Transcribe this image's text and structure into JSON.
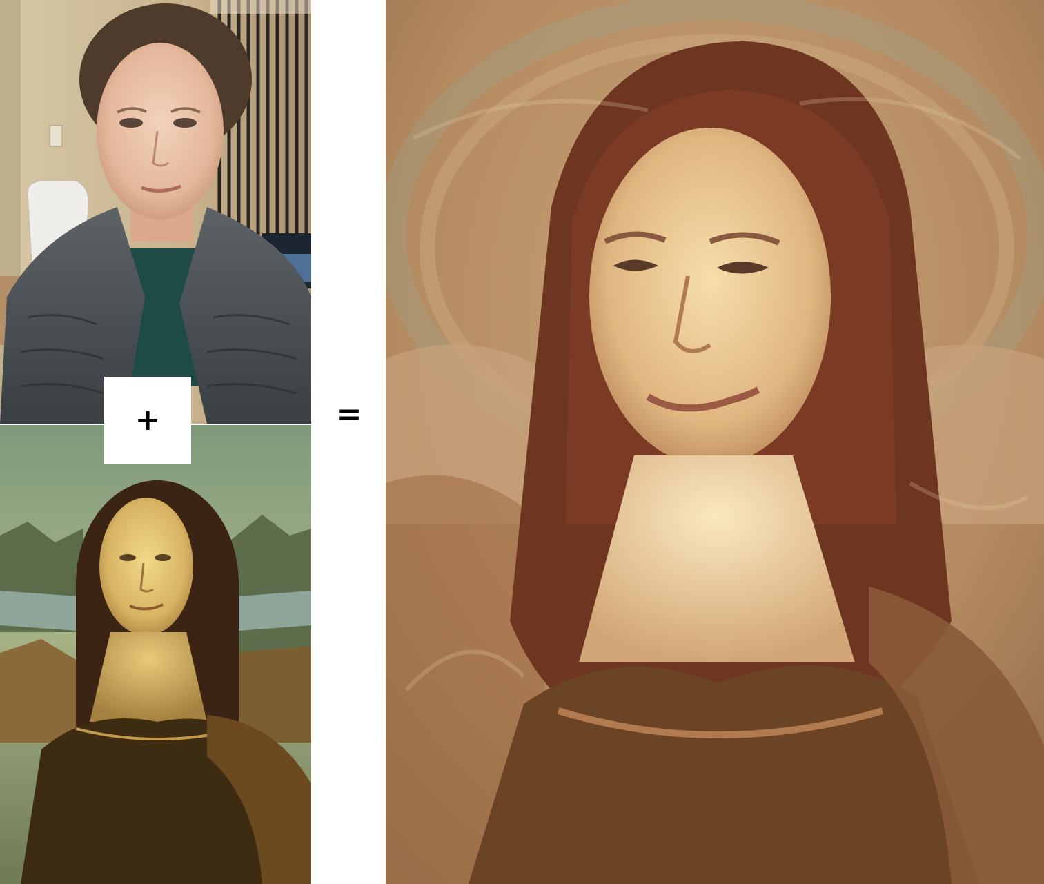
{
  "operators": {
    "plus": "+",
    "equals": "="
  },
  "images": {
    "photo": "photo-icon",
    "painting": "painting-icon",
    "result": "stylized-portrait-icon"
  },
  "colors": {
    "background": "#ffffff",
    "operator_text": "#000000",
    "painting_sky": "#8aa07a",
    "painting_skin": "#d8b46a",
    "result_base": "#b78a5e"
  }
}
